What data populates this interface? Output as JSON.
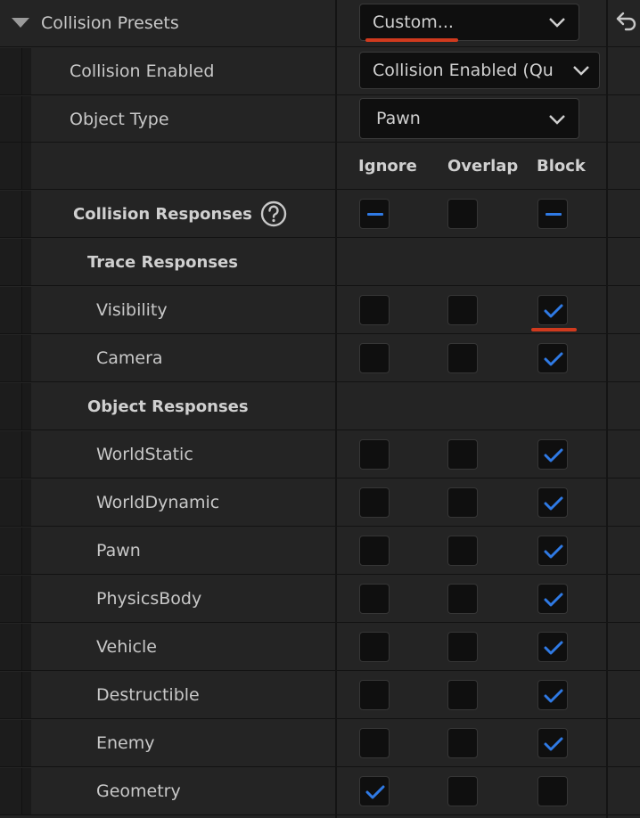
{
  "collision_presets": {
    "label": "Collision Presets",
    "value": "Custom...",
    "reset_icon": "undo-arrow-icon"
  },
  "collision_enabled": {
    "label": "Collision Enabled",
    "value": "Collision Enabled (Qu"
  },
  "object_type": {
    "label": "Object Type",
    "value": "Pawn"
  },
  "columns": {
    "ignore": "Ignore",
    "overlap": "Overlap",
    "block": "Block"
  },
  "collision_responses": {
    "label": "Collision Responses",
    "help_icon": "question-circle-icon",
    "ignore": "mixed",
    "overlap": "unchecked",
    "block": "mixed"
  },
  "trace_responses": {
    "label": "Trace Responses",
    "items": [
      {
        "name": "Visibility",
        "ignore": false,
        "overlap": false,
        "block": true
      },
      {
        "name": "Camera",
        "ignore": false,
        "overlap": false,
        "block": true
      }
    ]
  },
  "object_responses": {
    "label": "Object Responses",
    "items": [
      {
        "name": "WorldStatic",
        "ignore": false,
        "overlap": false,
        "block": true
      },
      {
        "name": "WorldDynamic",
        "ignore": false,
        "overlap": false,
        "block": true
      },
      {
        "name": "Pawn",
        "ignore": false,
        "overlap": false,
        "block": true
      },
      {
        "name": "PhysicsBody",
        "ignore": false,
        "overlap": false,
        "block": true
      },
      {
        "name": "Vehicle",
        "ignore": false,
        "overlap": false,
        "block": true
      },
      {
        "name": "Destructible",
        "ignore": false,
        "overlap": false,
        "block": true
      },
      {
        "name": "Enemy",
        "ignore": false,
        "overlap": false,
        "block": true
      },
      {
        "name": "Geometry",
        "ignore": true,
        "overlap": false,
        "block": false
      }
    ]
  },
  "colors": {
    "accent": "#2f7ae5",
    "highlight": "#d03a1e"
  }
}
